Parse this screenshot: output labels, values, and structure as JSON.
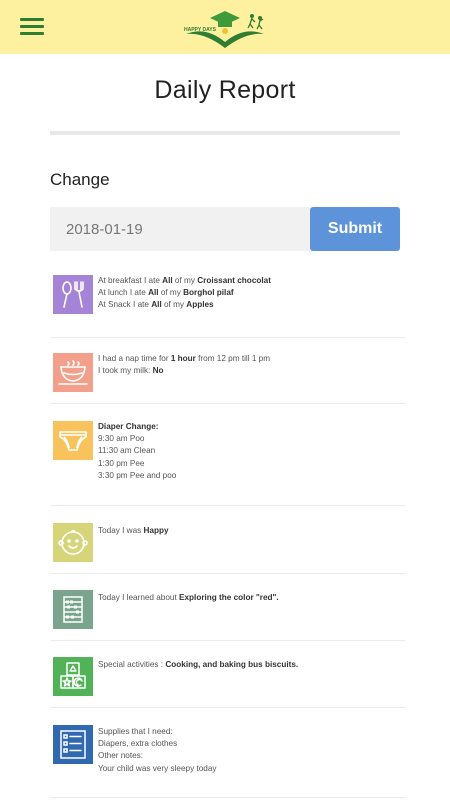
{
  "header": {
    "menu_icon": "hamburger-menu-icon",
    "logo_text": "HAPPY DAYS",
    "colors": {
      "bar": "#fdf1a0",
      "brand": "#2e7d32"
    }
  },
  "page": {
    "title": "Daily Report"
  },
  "change": {
    "label": "Change",
    "date_value": "2018-01-19",
    "submit_label": "Submit"
  },
  "entries": [
    {
      "icon": "utensils-icon",
      "color": "#a584d8",
      "lines": [
        {
          "pre": "At breakfast I ate ",
          "qty": "All",
          "mid": " of my ",
          "item": "Croissant chocolat"
        },
        {
          "pre": "At lunch I ate ",
          "qty": "All",
          "mid": " of my ",
          "item": "Borghol pilaf"
        },
        {
          "pre": "At Snack I ate ",
          "qty": "All",
          "mid": " of my ",
          "item": "Apples"
        }
      ]
    },
    {
      "icon": "teacup-icon",
      "color": "#f2a08c",
      "nap": {
        "pre": "I had a nap time for ",
        "duration": "1 hour",
        "post": " from 12 pm till 1 pm"
      },
      "milk": {
        "pre": "I took my milk: ",
        "value": "No"
      }
    },
    {
      "icon": "diaper-icon",
      "color": "#f8c35c",
      "heading": "Diaper Change:",
      "lines": [
        "9:30 am Poo",
        "11:30 am Clean",
        "1:30 pm Pee",
        "3:30 pm Pee and poo"
      ]
    },
    {
      "icon": "baby-face-icon",
      "color": "#d7d57a",
      "pre": "Today I was ",
      "value": "Happy"
    },
    {
      "icon": "abacus-icon",
      "color": "#7aa48c",
      "pre": "Today I learned about ",
      "value": "Exploring the color \"red\"."
    },
    {
      "icon": "toy-blocks-icon",
      "color": "#52b257",
      "pre": "Special activities : ",
      "value": "Cooking, and baking bus biscuits."
    },
    {
      "icon": "checklist-icon",
      "color": "#3169b0",
      "lines": [
        "Supplies that I need:",
        "Diapers, extra clothes",
        "Other notes:",
        "Your child was very sleepy today"
      ]
    }
  ]
}
